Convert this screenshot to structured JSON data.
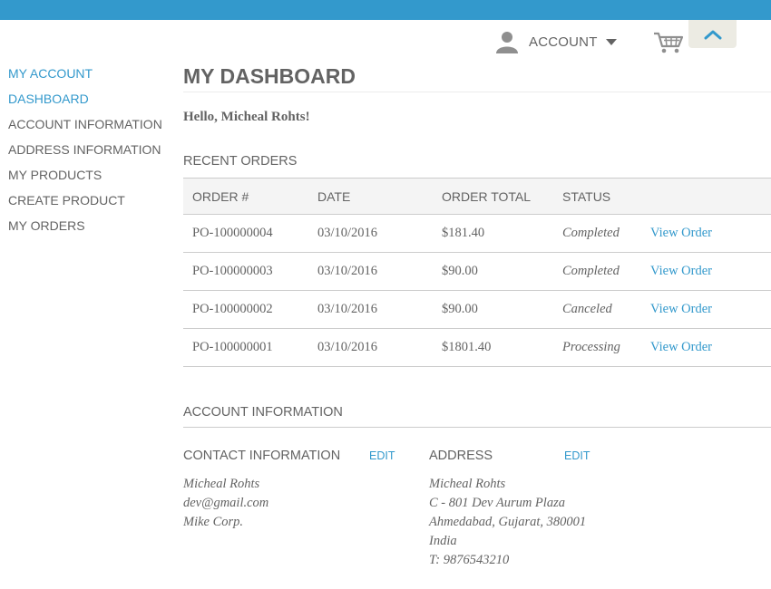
{
  "header": {
    "account_label": "ACCOUNT",
    "icons": {
      "user": "user-icon",
      "caret": "caret-down-icon",
      "cart": "cart-icon",
      "up": "chevron-up-icon"
    },
    "colors": {
      "accent": "#3399cc",
      "topbar": "#3399cc",
      "tab_bg": "#ecebe3"
    }
  },
  "sidebar": {
    "title": "MY ACCOUNT",
    "items": [
      {
        "label": "DASHBOARD",
        "active": true
      },
      {
        "label": "ACCOUNT INFORMATION",
        "active": false
      },
      {
        "label": "ADDRESS INFORMATION",
        "active": false
      },
      {
        "label": "MY PRODUCTS",
        "active": false
      },
      {
        "label": "CREATE PRODUCT",
        "active": false
      },
      {
        "label": "MY ORDERS",
        "active": false
      }
    ]
  },
  "main": {
    "title": "MY DASHBOARD",
    "greeting": "Hello, Micheal Rohts!",
    "recent_orders": {
      "heading": "RECENT ORDERS",
      "columns": [
        "ORDER #",
        "DATE",
        "ORDER TOTAL",
        "STATUS",
        ""
      ],
      "rows": [
        {
          "order": "PO-100000004",
          "date": "03/10/2016",
          "total": "$181.40",
          "status": "Completed",
          "action": "View Order"
        },
        {
          "order": "PO-100000003",
          "date": "03/10/2016",
          "total": "$90.00",
          "status": "Completed",
          "action": "View Order"
        },
        {
          "order": "PO-100000002",
          "date": "03/10/2016",
          "total": "$90.00",
          "status": "Canceled",
          "action": "View Order"
        },
        {
          "order": "PO-100000001",
          "date": "03/10/2016",
          "total": "$1801.40",
          "status": "Processing",
          "action": "View Order"
        }
      ]
    },
    "account_info": {
      "heading": "ACCOUNT INFORMATION",
      "contact": {
        "heading": "CONTACT INFORMATION",
        "edit_label": "EDIT",
        "lines": [
          "Micheal Rohts",
          "dev@gmail.com",
          "Mike Corp."
        ]
      },
      "address": {
        "heading": "ADDRESS",
        "edit_label": "EDIT",
        "lines": [
          "Micheal Rohts",
          "C - 801 Dev Aurum Plaza",
          "Ahmedabad, Gujarat, 380001",
          "India",
          "T: 9876543210"
        ]
      }
    }
  }
}
